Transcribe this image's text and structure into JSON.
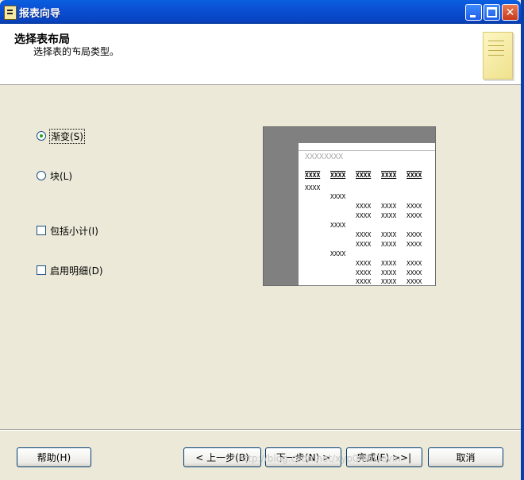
{
  "window": {
    "title": "报表向导"
  },
  "header": {
    "title": "选择表布局",
    "subtitle": "选择表的布局类型。"
  },
  "options": {
    "gradient": {
      "label": "渐变(S)",
      "selected": true
    },
    "block": {
      "label": "块(L)",
      "selected": false
    },
    "subtotals": {
      "label": "包括小计(I)",
      "checked": false
    },
    "details": {
      "label": "启用明细(D)",
      "checked": false
    }
  },
  "preview": {
    "placeholder": "XXXXXXXX",
    "headers": [
      "XXXX",
      "XXXX",
      "XXXX",
      "XXXX",
      "XXXX"
    ],
    "cells": [
      "XXXX",
      "XXXX",
      "XXXX",
      "XXXX",
      "XXXX",
      "XXXX",
      "XXXX",
      "XXXX",
      "XXXX",
      "XXXX",
      "XXXX",
      "XXXX",
      "XXXX",
      "XXXX",
      "XXXX",
      "XXXX",
      "XXXX",
      "XXXX",
      "XXXX",
      "XXXX",
      "XXXX",
      "XXXX",
      "XXXX",
      "XXXX",
      "XXXX"
    ]
  },
  "buttons": {
    "help": "帮助(H)",
    "back": "< 上一步(B)",
    "next": "下一步(N) >",
    "finish": "完成(F) >>|",
    "cancel": "取消"
  },
  "watermark": "http://blog.csdn.net/xyp0nlbDevin"
}
